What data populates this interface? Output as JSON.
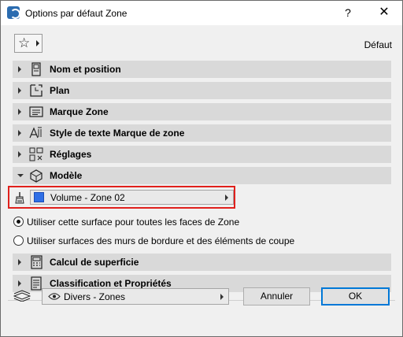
{
  "window": {
    "title": "Options par défaut Zone",
    "help_label": "?",
    "close_label": "✕"
  },
  "favorites": {
    "star_glyph": "☆",
    "preset_label": "Défaut"
  },
  "panels": [
    {
      "label": "Nom et position",
      "icon": "tag-icon",
      "expanded": false
    },
    {
      "label": "Plan",
      "icon": "plan-icon",
      "expanded": false
    },
    {
      "label": "Marque Zone",
      "icon": "zone-stamp-icon",
      "expanded": false
    },
    {
      "label": "Style de texte Marque de zone",
      "icon": "text-style-icon",
      "expanded": false
    },
    {
      "label": "Réglages",
      "icon": "settings-grid-icon",
      "expanded": false
    },
    {
      "label": "Modèle",
      "icon": "cube-icon",
      "expanded": true
    },
    {
      "label": "Calcul de superficie",
      "icon": "calculator-icon",
      "expanded": false
    },
    {
      "label": "Classification et Propriétés",
      "icon": "list-doc-icon",
      "expanded": false
    }
  ],
  "model": {
    "surface_label": "Volume - Zone 02",
    "surface_color": "#2f6fe6",
    "radio_all_faces": "Utiliser cette surface pour toutes les faces de Zone",
    "radio_boundary": "Utiliser surfaces des murs de bordure et des éléments de coupe",
    "selected_radio": "radio_all_faces"
  },
  "footer": {
    "layer_label": "Divers - Zones",
    "cancel_label": "Annuler",
    "ok_label": "OK"
  },
  "colors": {
    "highlight_border": "#e0201c",
    "default_button_border": "#0078d7",
    "panel_bg": "#d9d9d9"
  }
}
